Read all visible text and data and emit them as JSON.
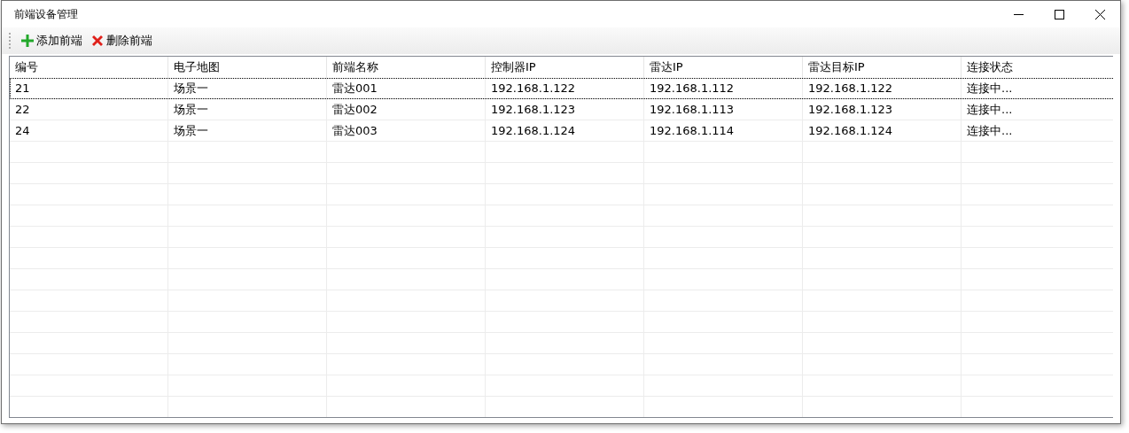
{
  "window": {
    "title": "前端设备管理"
  },
  "toolbar": [
    {
      "kind": "add",
      "label": "添加前端"
    },
    {
      "kind": "delete",
      "label": "删除前端"
    }
  ],
  "table": {
    "columns": [
      "编号",
      "电子地图",
      "前端名称",
      "控制器IP",
      "雷达IP",
      "雷达目标IP",
      "连接状态"
    ],
    "rows": [
      {
        "focused": true,
        "cells": [
          "21",
          "场景一",
          "雷达001",
          "192.168.1.122",
          "192.168.1.112",
          "192.168.1.122",
          "连接中..."
        ]
      },
      {
        "focused": false,
        "cells": [
          "22",
          "场景一",
          "雷达002",
          "192.168.1.123",
          "192.168.1.113",
          "192.168.1.123",
          "连接中..."
        ]
      },
      {
        "focused": false,
        "cells": [
          "24",
          "场景一",
          "雷达003",
          "192.168.1.124",
          "192.168.1.114",
          "192.168.1.124",
          "连接中..."
        ]
      }
    ]
  }
}
